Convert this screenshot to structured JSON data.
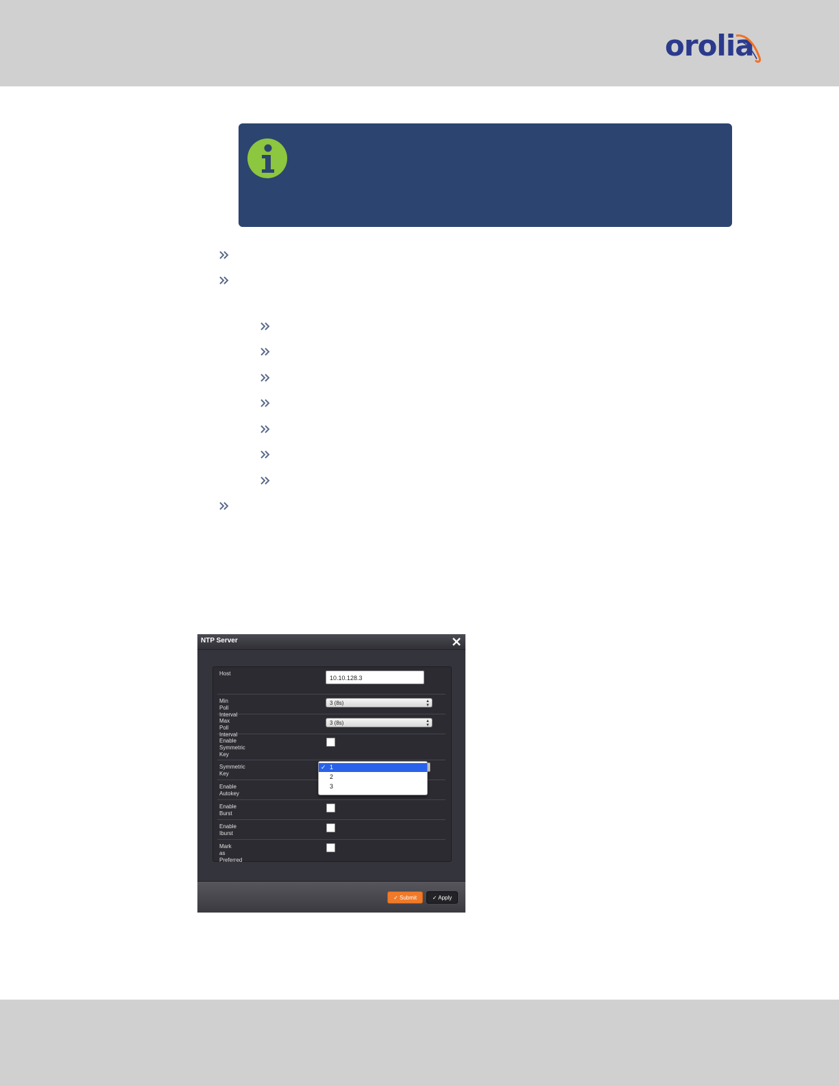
{
  "header": {
    "logo_text": "orolia",
    "brand_color": "#2b3a8c",
    "accent_color": "#f37021"
  },
  "note": {
    "icon": "info-icon",
    "background": "#2c4470",
    "icon_color": "#8dc63f"
  },
  "dialog": {
    "title": "NTP Server",
    "close_icon": "close-icon",
    "fields": [
      {
        "label": "Host",
        "type": "text",
        "value": "10.10.128.3"
      },
      {
        "label": "Min Poll Interval",
        "type": "select",
        "value": "3 (8s)"
      },
      {
        "label": "Max Poll Interval",
        "type": "select",
        "value": "3 (8s)"
      },
      {
        "label": "Enable Symmetric Key",
        "type": "checkbox",
        "checked": false
      },
      {
        "label": "Symmetric Key",
        "type": "select",
        "value": "1"
      },
      {
        "label": "Enable Autokey",
        "type": "checkbox",
        "checked": false
      },
      {
        "label": "Enable Burst",
        "type": "checkbox",
        "checked": false
      },
      {
        "label": "Enable Iburst",
        "type": "checkbox",
        "checked": false
      },
      {
        "label": "Mark as Preferred",
        "type": "checkbox",
        "checked": false
      }
    ],
    "dropdown_options": [
      "1",
      "2",
      "3"
    ],
    "dropdown_selected": "1",
    "dropdown_check": "✓",
    "submit_label": "Submit",
    "apply_label": "Apply",
    "submit_color": "#f07a29"
  }
}
